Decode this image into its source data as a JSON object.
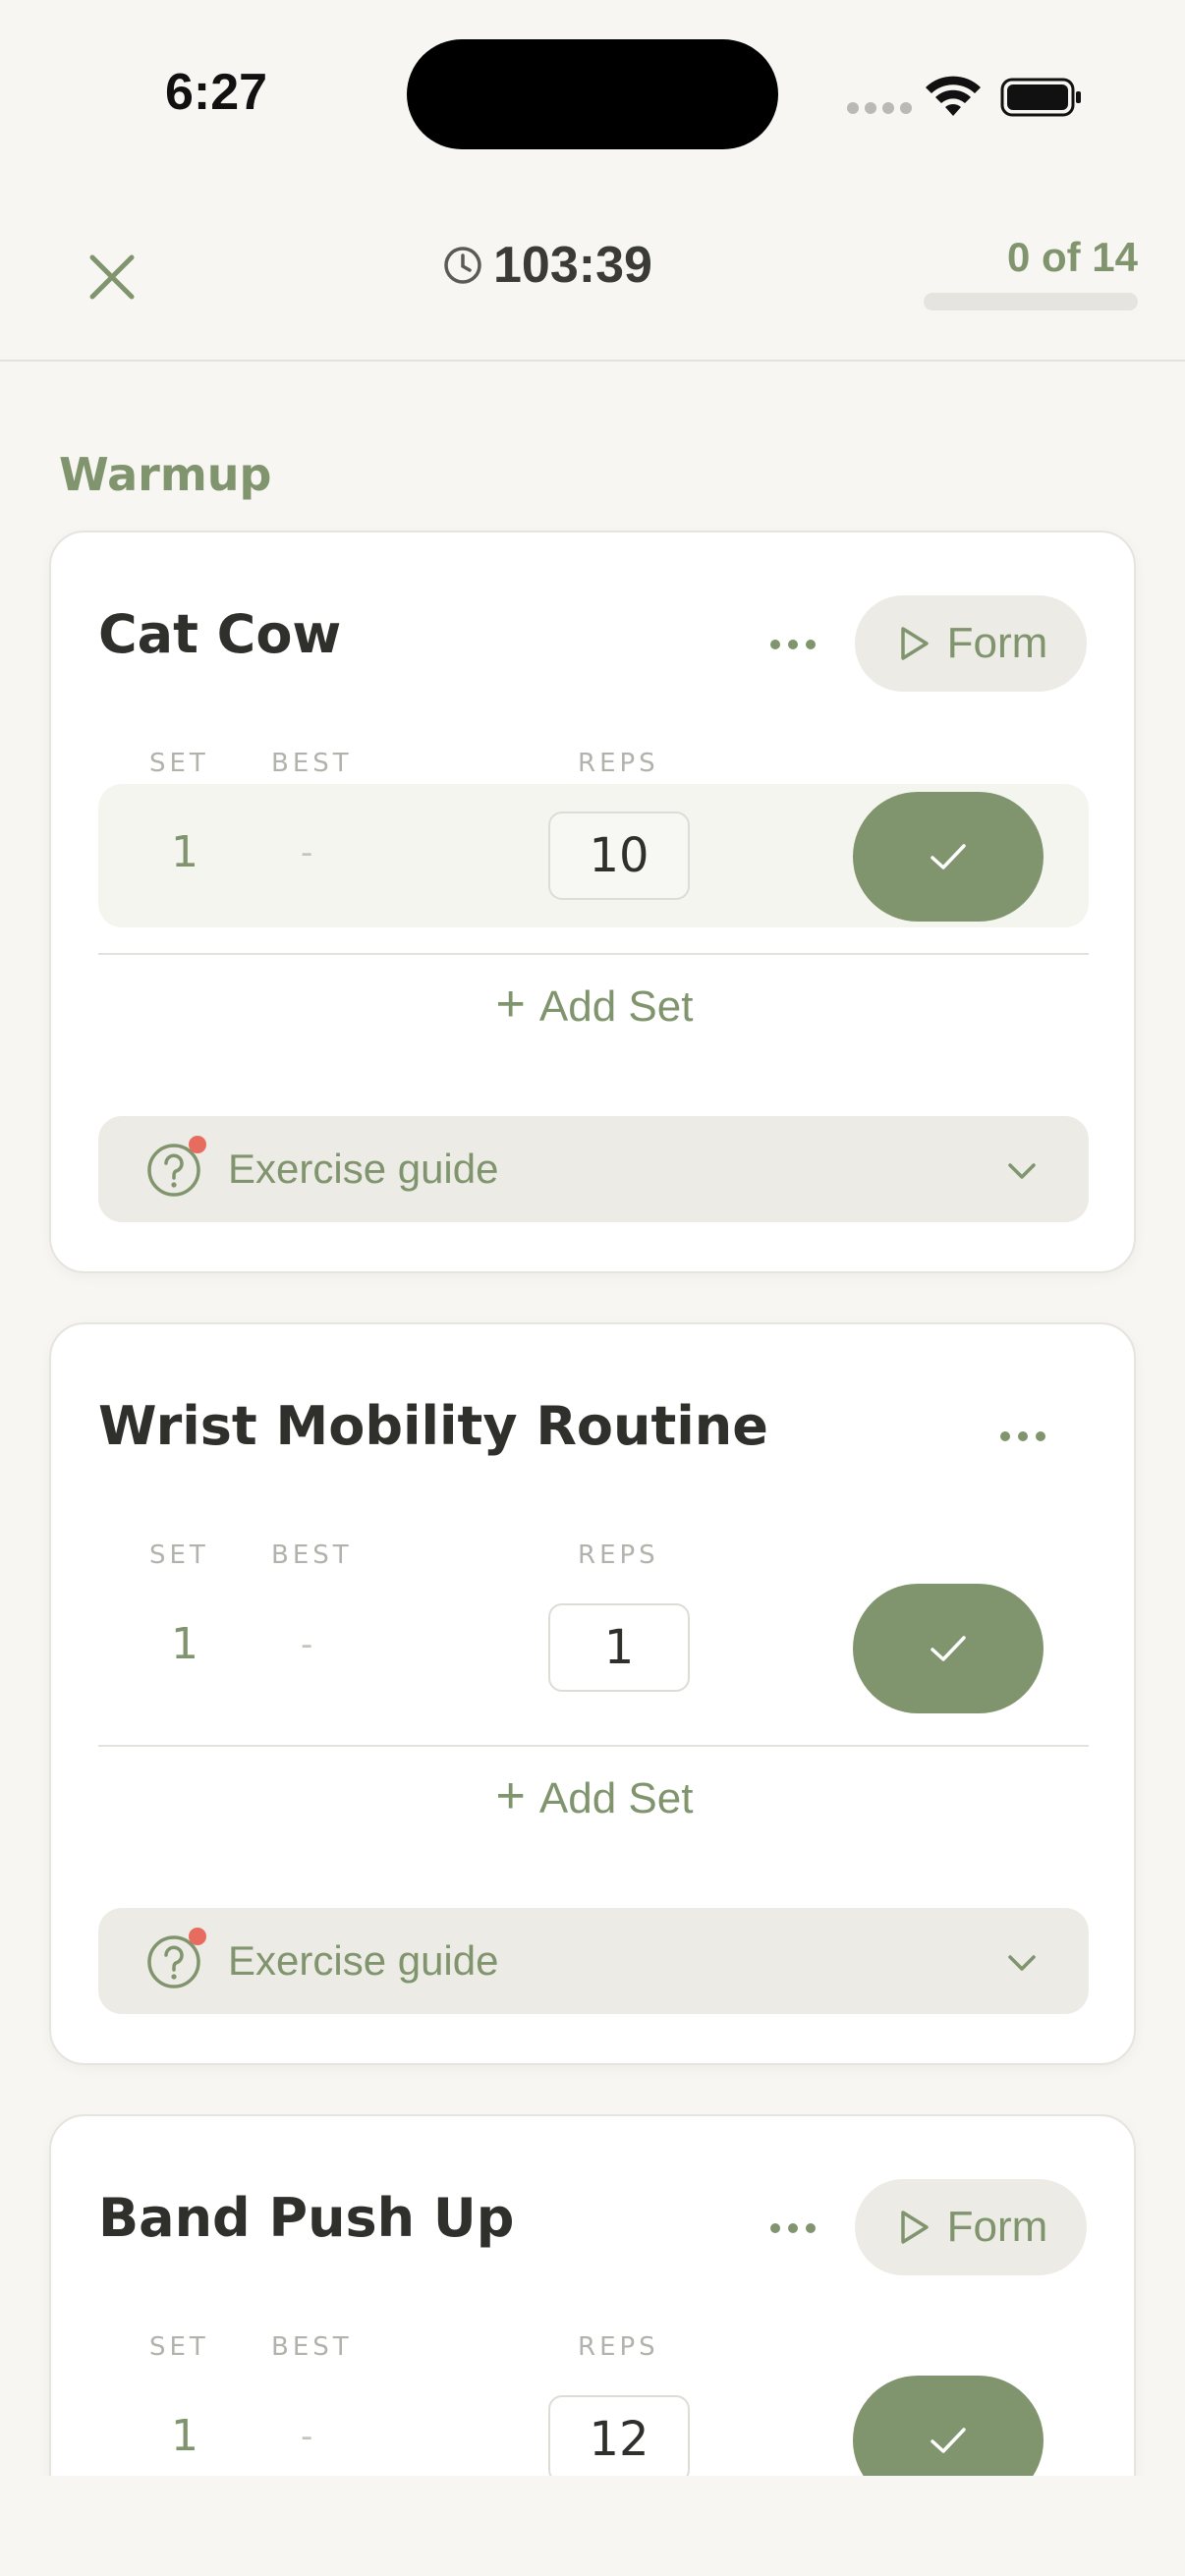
{
  "status_bar": {
    "time": "6:27"
  },
  "header": {
    "timer": "103:39",
    "progress_text": "0 of 14",
    "progress_fraction": 0
  },
  "section": {
    "title": "Warmup"
  },
  "exercises": [
    {
      "name": "Cat Cow",
      "has_form": true,
      "form_label": "Form",
      "col_set": "SET",
      "col_best": "BEST",
      "col_reps": "REPS",
      "sets": [
        {
          "set": "1",
          "best": "-",
          "reps": "10"
        }
      ],
      "add_set_label": "Add Set",
      "guide_label": "Exercise guide"
    },
    {
      "name": "Wrist Mobility Routine",
      "has_form": false,
      "col_set": "SET",
      "col_best": "BEST",
      "col_reps": "REPS",
      "sets": [
        {
          "set": "1",
          "best": "-",
          "reps": "1"
        }
      ],
      "add_set_label": "Add Set",
      "guide_label": "Exercise guide"
    },
    {
      "name": "Band Push Up",
      "has_form": true,
      "form_label": "Form",
      "col_set": "SET",
      "col_best": "BEST",
      "col_reps": "REPS",
      "sets": [
        {
          "set": "1",
          "best": "-",
          "reps": "12"
        }
      ]
    }
  ],
  "colors": {
    "accent": "#80946d",
    "background": "#f7f6f2",
    "notification_dot": "#e86b5f"
  }
}
